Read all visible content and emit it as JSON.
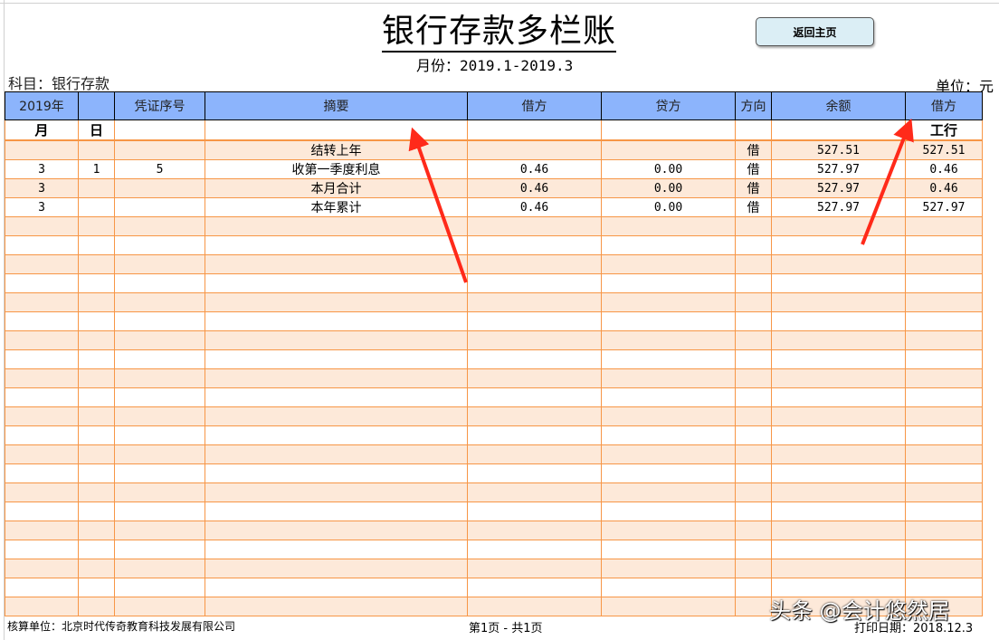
{
  "title": "银行存款多栏账",
  "period": "月份：2019.1-2019.3",
  "home_button": "返回主页",
  "subject": "科目：银行存款",
  "unit": "单位：元",
  "headers": [
    "2019年",
    "",
    "凭证序号",
    "摘要",
    "借方",
    "贷方",
    "方向",
    "余额",
    "借方"
  ],
  "subheaders": [
    "月",
    "日",
    "",
    "",
    "",
    "",
    "",
    "",
    "工行"
  ],
  "rows": [
    [
      "",
      "",
      "",
      "结转上年",
      "",
      "",
      "借",
      "527.51",
      "527.51"
    ],
    [
      "3",
      "1",
      "5",
      "收第一季度利息",
      "0.46",
      "0.00",
      "借",
      "527.97",
      "0.46"
    ],
    [
      "3",
      "",
      "",
      "本月合计",
      "0.46",
      "0.00",
      "借",
      "527.97",
      "0.46"
    ],
    [
      "3",
      "",
      "",
      "本年累计",
      "0.46",
      "0.00",
      "借",
      "527.97",
      "527.97"
    ]
  ],
  "footer": {
    "company": "核算单位：北京时代传奇教育科技发展有限公司",
    "page": "第1页 - 共1页",
    "print_date": "打印日期：2018.12.3"
  },
  "watermark": "头条 @会计悠然居",
  "colors": {
    "header_bg": "#8cb4fc",
    "row_shade": "#fde9d9",
    "border": "#f79646",
    "arrow": "#ff2a1a"
  }
}
